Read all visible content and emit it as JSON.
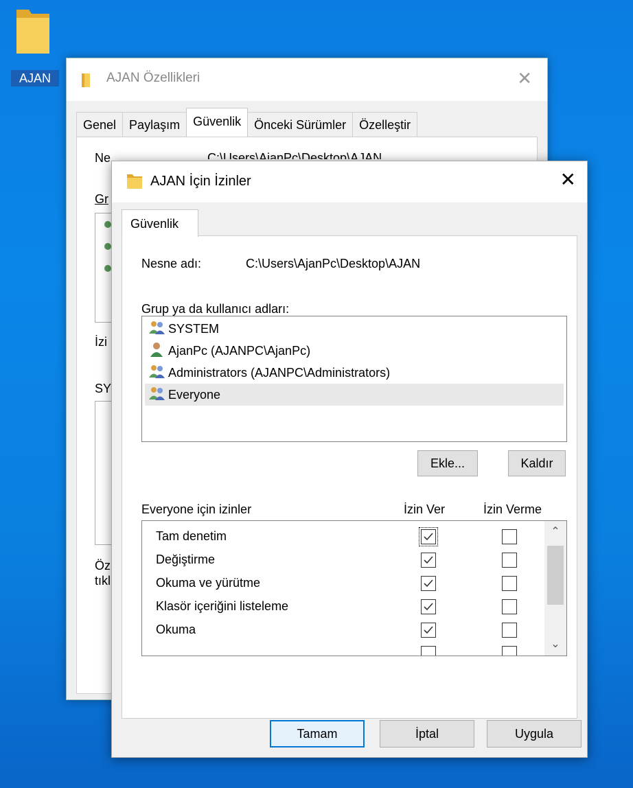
{
  "desktop": {
    "folder_label": "AJAN"
  },
  "background_window": {
    "title": "AJAN Özellikleri",
    "tabs": [
      {
        "label": "Genel"
      },
      {
        "label": "Paylaşım"
      },
      {
        "label": "Güvenlik",
        "active": true
      },
      {
        "label": "Önceki Sürümler"
      },
      {
        "label": "Özelleştir"
      }
    ],
    "visible_fragments": {
      "object_label_partial": "Ne",
      "object_path_partial": "C:\\Users\\AjanPc\\Desktop\\AJAN",
      "group_label_partial": "Gr",
      "izin_partial": "İzi",
      "sy_partial": "SY",
      "oz_partial": "Öz",
      "tik_partial": "tıkl"
    }
  },
  "dialog": {
    "title": "AJAN İçin İzinler",
    "tab": "Güvenlik",
    "object_label": "Nesne adı:",
    "object_path": "C:\\Users\\AjanPc\\Desktop\\AJAN",
    "group_label": "Grup ya da kullanıcı adları:",
    "users": [
      {
        "name": "SYSTEM",
        "icon": "group-users-icon"
      },
      {
        "name": "AjanPc (AJANPC\\AjanPc)",
        "icon": "user-icon"
      },
      {
        "name": "Administrators (AJANPC\\Administrators)",
        "icon": "group-users-icon"
      },
      {
        "name": "Everyone",
        "icon": "group-users-icon",
        "selected": true
      }
    ],
    "add_button": "Ekle...",
    "remove_button": "Kaldır",
    "permissions_label": "Everyone için izinler",
    "allow_header": "İzin Ver",
    "deny_header": "İzin Verme",
    "permissions": [
      {
        "name": "Tam denetim",
        "allow": true,
        "deny": false
      },
      {
        "name": "Değiştirme",
        "allow": true,
        "deny": false
      },
      {
        "name": "Okuma ve yürütme",
        "allow": true,
        "deny": false
      },
      {
        "name": "Klasör içeriğini listeleme",
        "allow": true,
        "deny": false
      },
      {
        "name": "Okuma",
        "allow": true,
        "deny": false
      }
    ],
    "ok_button": "Tamam",
    "cancel_button": "İptal",
    "apply_button": "Uygula"
  },
  "colors": {
    "desktop_blue": "#0a86e8",
    "accent": "#0078d7",
    "folder_yellow": "#f2c94c"
  }
}
